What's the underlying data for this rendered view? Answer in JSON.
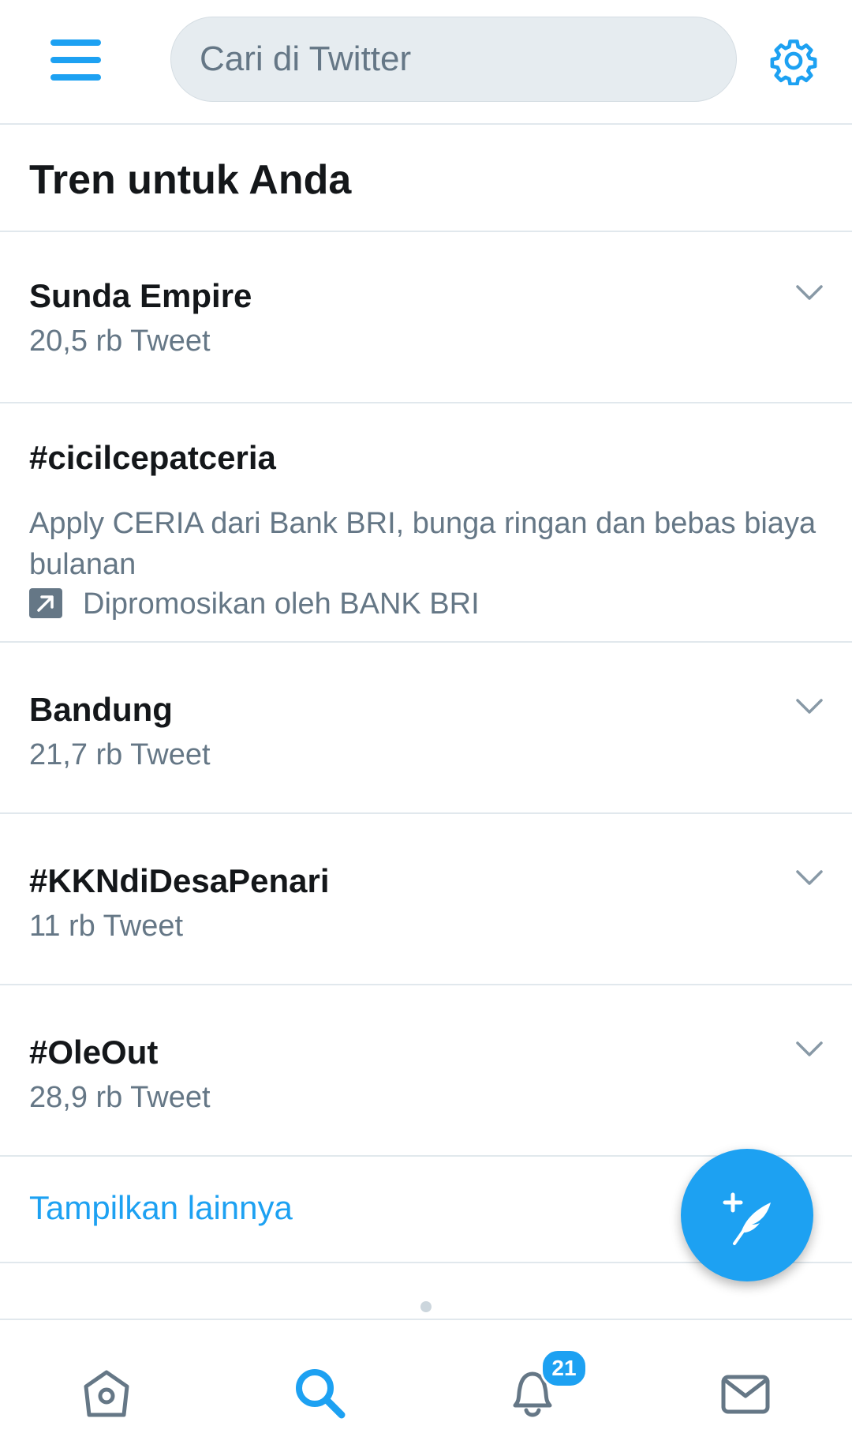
{
  "header": {
    "search_placeholder": "Cari di Twitter",
    "menu_icon": "hamburger-menu-icon",
    "settings_icon": "gear-icon"
  },
  "section": {
    "title": "Tren untuk Anda"
  },
  "trends": [
    {
      "name": "Sunda Empire",
      "count": "20,5 rb Tweet"
    },
    {
      "name": "#cicilcepatceria",
      "description": "Apply CERIA dari Bank BRI, bunga ringan dan bebas biaya bulanan",
      "promoted": "Dipromosikan oleh BANK BRI"
    },
    {
      "name": "Bandung",
      "count": "21,7 rb Tweet"
    },
    {
      "name": "#KKNdiDesaPenari",
      "count": "11 rb Tweet"
    },
    {
      "name": "#OleOut",
      "count": "28,9 rb Tweet"
    }
  ],
  "show_more": "Tampilkan lainnya",
  "nav": {
    "notifications_badge": "21"
  },
  "colors": {
    "accent": "#1da1f2",
    "secondary_text": "#657786",
    "divider": "#e1e8ed"
  }
}
